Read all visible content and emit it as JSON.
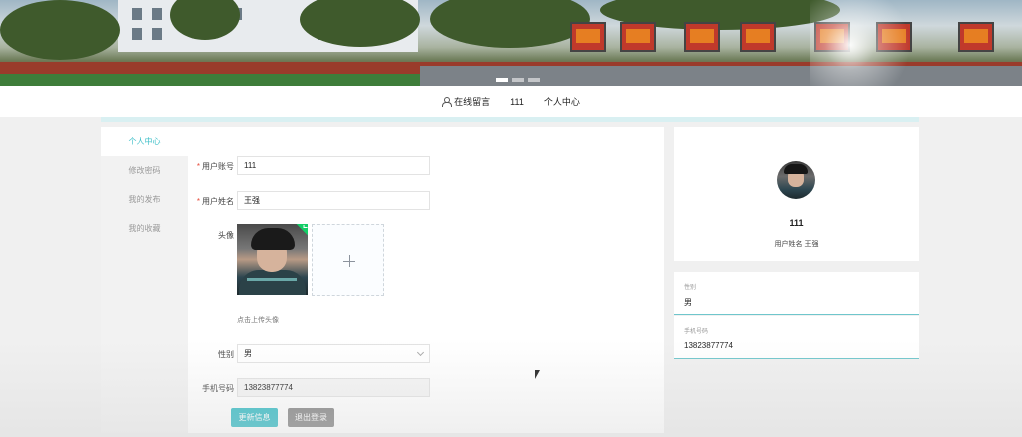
{
  "banner": {
    "slides": 3,
    "active_slide": 1
  },
  "nav": {
    "items": [
      {
        "label": "在线留言",
        "icon": "person-icon"
      },
      {
        "label": "111"
      },
      {
        "label": "个人中心"
      }
    ]
  },
  "menu": {
    "items": [
      {
        "label": "个人中心",
        "active": true
      },
      {
        "label": "修改密码"
      },
      {
        "label": "我的发布"
      },
      {
        "label": "我的收藏"
      }
    ]
  },
  "form": {
    "account": {
      "label": "用户账号",
      "value": "111",
      "required": true
    },
    "name": {
      "label": "用户姓名",
      "value": "王强",
      "required": true
    },
    "avatar": {
      "label": "头像",
      "hint": "点击上传头像",
      "uploaded": true
    },
    "gender": {
      "label": "性别",
      "value": "男"
    },
    "phone": {
      "label": "手机号码",
      "value": "13823877774"
    },
    "buttons": {
      "update": "更新信息",
      "logout": "退出登录"
    }
  },
  "profile": {
    "username": "111",
    "fullname_label": "用户姓名",
    "fullname": "王强",
    "gender_label": "性别",
    "gender": "男",
    "phone_label": "手机号码",
    "phone": "13823877774"
  },
  "colors": {
    "accent": "#3dbfc8",
    "secondary_button": "#8a8a8a",
    "required_mark": "#e74c3c",
    "upload_success": "#13ce66"
  }
}
